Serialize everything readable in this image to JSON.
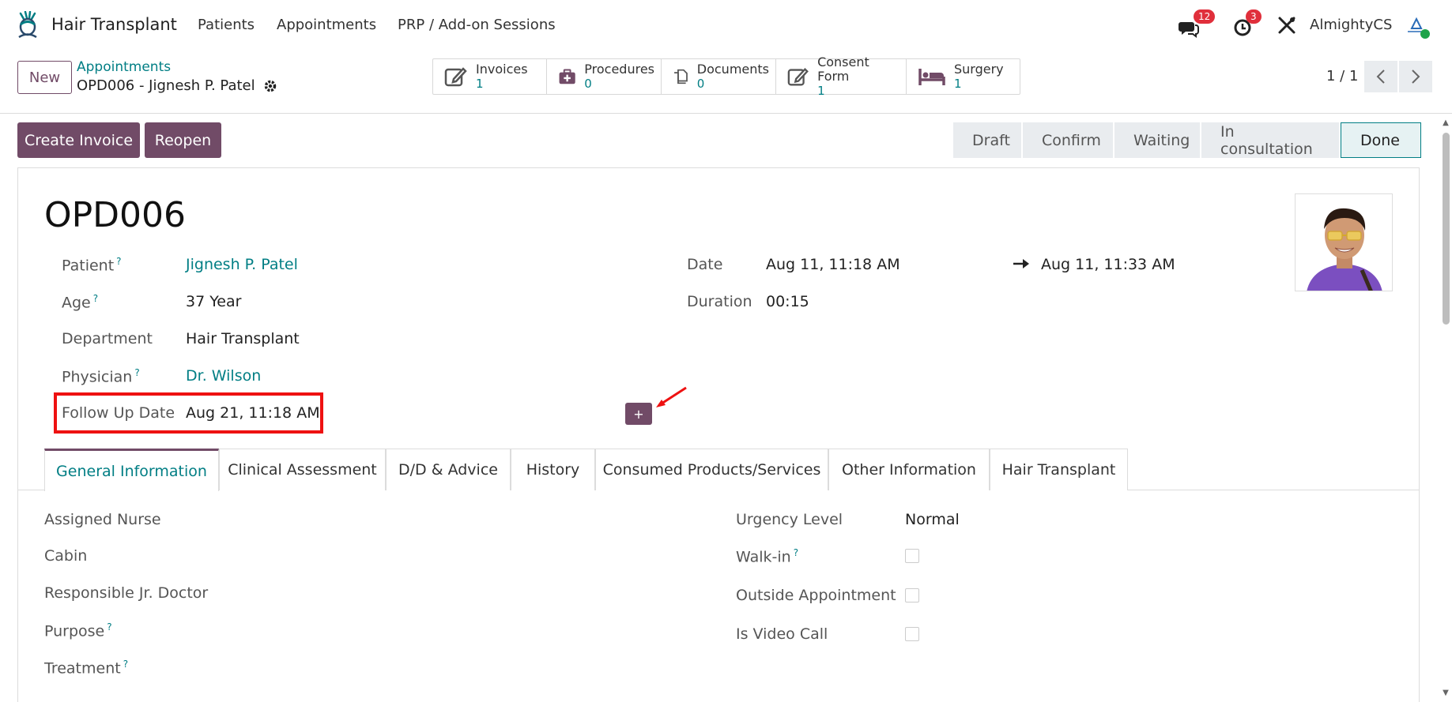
{
  "navbar": {
    "app_name": "Hair Transplant",
    "menu": [
      "Patients",
      "Appointments",
      "PRP / Add-on Sessions"
    ],
    "messages_count": "12",
    "activities_count": "3",
    "user_name": "AlmightyCS"
  },
  "control": {
    "new_label": "New",
    "breadcrumb_parent": "Appointments",
    "breadcrumb_current": "OPD006 - Jignesh P. Patel",
    "smart_buttons": [
      {
        "label": "Invoices",
        "value": "1"
      },
      {
        "label": "Procedures",
        "value": "0"
      },
      {
        "label": "Documents",
        "value": "0"
      },
      {
        "label": "Consent Form",
        "value": "1"
      },
      {
        "label": "Surgery",
        "value": "1"
      }
    ],
    "pager": "1 / 1"
  },
  "actions": {
    "create_invoice": "Create Invoice",
    "reopen": "Reopen"
  },
  "statusbar": [
    "Draft",
    "Confirm",
    "Waiting",
    "In consultation",
    "Done"
  ],
  "form": {
    "title": "OPD006",
    "help_mark": "?",
    "patient_label": "Patient",
    "patient_value": "Jignesh P. Patel",
    "age_label": "Age",
    "age_value": "37 Year",
    "department_label": "Department",
    "department_value": "Hair Transplant",
    "physician_label": "Physician",
    "physician_value": "Dr. Wilson",
    "followup_label": "Follow Up Date",
    "followup_value": "Aug 21, 11:18 AM",
    "date_label": "Date",
    "date_start": "Aug 11, 11:18 AM",
    "date_end": "Aug 11, 11:33 AM",
    "duration_label": "Duration",
    "duration_value": "00:15",
    "plus_label": "+"
  },
  "tabs": [
    "General Information",
    "Clinical Assessment",
    "D/D & Advice",
    "History",
    "Consumed Products/Services",
    "Other Information",
    "Hair Transplant"
  ],
  "general": {
    "assigned_nurse": "Assigned Nurse",
    "cabin": "Cabin",
    "responsible_jr_doctor": "Responsible Jr. Doctor",
    "purpose": "Purpose",
    "treatment": "Treatment",
    "urgency_label": "Urgency Level",
    "urgency_value": "Normal",
    "walk_in": "Walk-in",
    "outside_appointment": "Outside Appointment",
    "is_video_call": "Is Video Call"
  },
  "colors": {
    "brand": "#714b67",
    "link": "#017e84",
    "highlight": "#e11111",
    "badge": "#e02f3b"
  }
}
